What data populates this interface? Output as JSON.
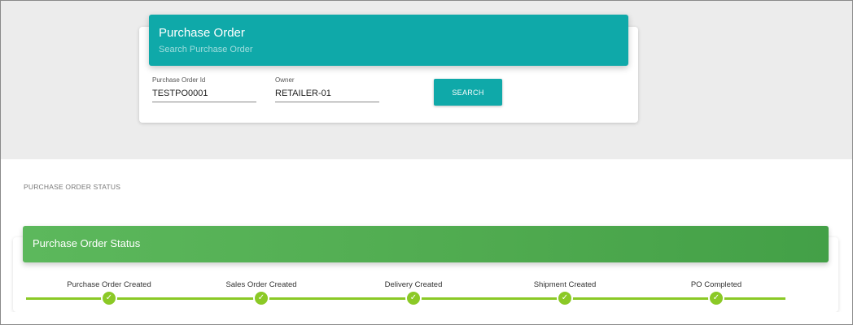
{
  "search": {
    "title": "Purchase Order",
    "subtitle": "Search Purchase Order",
    "fields": {
      "po_id": {
        "label": "Purchase Order Id",
        "value": "TESTPO0001"
      },
      "owner": {
        "label": "Owner",
        "value": "RETAILER-01"
      }
    },
    "button_label": "SEARCH"
  },
  "status_section": {
    "label": "PURCHASE ORDER STATUS",
    "card_title": "Purchase Order Status",
    "steps": [
      {
        "label": "Purchase Order Created",
        "check": "✓"
      },
      {
        "label": "Sales Order Created",
        "check": "✓"
      },
      {
        "label": "Delivery Created",
        "check": "✓"
      },
      {
        "label": "Shipment Created",
        "check": "✓"
      },
      {
        "label": "PO Completed",
        "check": "✓"
      }
    ]
  },
  "colors": {
    "accent_teal": "#0fa9a9",
    "status_green": "#4caf50",
    "progress_lime": "#8bc926",
    "background_gray": "#ececec"
  }
}
